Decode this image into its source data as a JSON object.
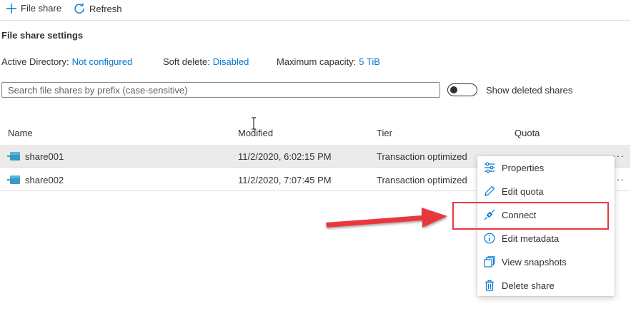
{
  "toolbar": {
    "add_label": "File share",
    "refresh_label": "Refresh"
  },
  "settings": {
    "title": "File share settings",
    "active_directory": {
      "label": "Active Directory:",
      "value": "Not configured"
    },
    "soft_delete": {
      "label": "Soft delete:",
      "value": "Disabled"
    },
    "max_capacity": {
      "label": "Maximum capacity:",
      "value": "5 TiB"
    }
  },
  "search": {
    "placeholder": "Search file shares by prefix (case-sensitive)"
  },
  "toggle": {
    "label": "Show deleted shares",
    "on": false
  },
  "table": {
    "headers": [
      "Name",
      "Modified",
      "Tier",
      "Quota"
    ],
    "rows": [
      {
        "name": "share001",
        "modified": "11/2/2020, 6:02:15 PM",
        "tier": "Transaction optimized",
        "selected": true
      },
      {
        "name": "share002",
        "modified": "11/2/2020, 7:07:45 PM",
        "tier": "Transaction optimized",
        "selected": false
      }
    ]
  },
  "context_menu": {
    "items": [
      {
        "label": "Properties",
        "icon": "properties-icon"
      },
      {
        "label": "Edit quota",
        "icon": "pencil-icon"
      },
      {
        "label": "Connect",
        "icon": "plug-icon"
      },
      {
        "label": "Edit metadata",
        "icon": "info-icon"
      },
      {
        "label": "View snapshots",
        "icon": "snapshots-icon"
      },
      {
        "label": "Delete share",
        "icon": "trash-icon"
      }
    ],
    "highlighted": "Connect"
  },
  "colors": {
    "accent": "#0078d4",
    "highlight": "#e8393d",
    "selected_row": "#edebe9"
  }
}
